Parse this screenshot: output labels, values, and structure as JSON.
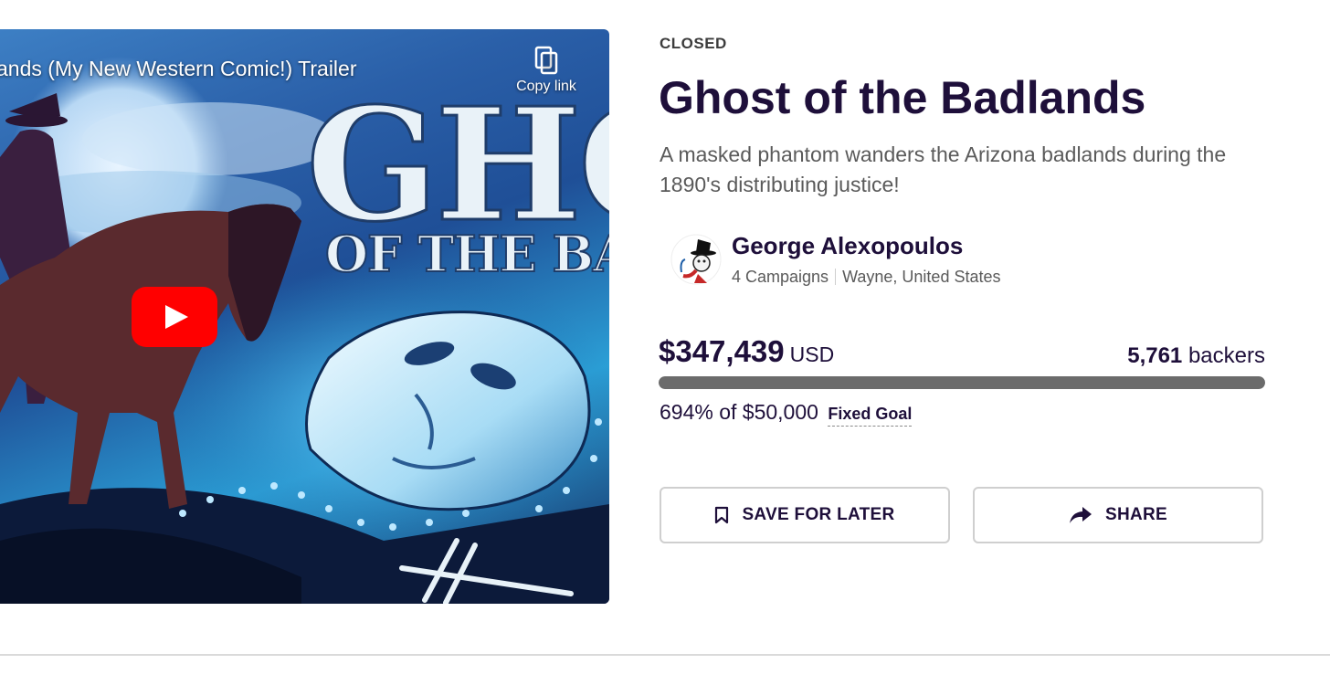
{
  "video": {
    "title": "ands (My New Western Comic!) Trailer",
    "copy_link_label": "Copy link",
    "cover_text_top": "GHOST",
    "cover_text_bottom": "OF THE BADLANDS",
    "play_icon": "youtube-play-icon",
    "play_color": "#ff0000"
  },
  "project": {
    "status": "CLOSED",
    "title": "Ghost of the Badlands",
    "blurb": "A masked phantom wanders the Arizona badlands during the 1890's distributing justice!"
  },
  "creator": {
    "name": "George Alexopoulos",
    "campaigns": "4 Campaigns",
    "location": "Wayne, United States"
  },
  "funding": {
    "amount": "$347,439",
    "currency": "USD",
    "backers_count": "5,761",
    "backers_label": "backers",
    "percent_of_goal": "694% of $50,000",
    "goal_type": "Fixed Goal",
    "progress_fraction": 1.0
  },
  "actions": {
    "save_label": "SAVE FOR LATER",
    "save_icon": "bookmark-icon",
    "share_label": "SHARE",
    "share_icon": "share-arrow-icon"
  },
  "colors": {
    "title_text": "#1e0f3a",
    "progress_fill": "#6b6b6b",
    "progress_track": "#dcdcdc",
    "button_border": "#cfcfcf"
  }
}
